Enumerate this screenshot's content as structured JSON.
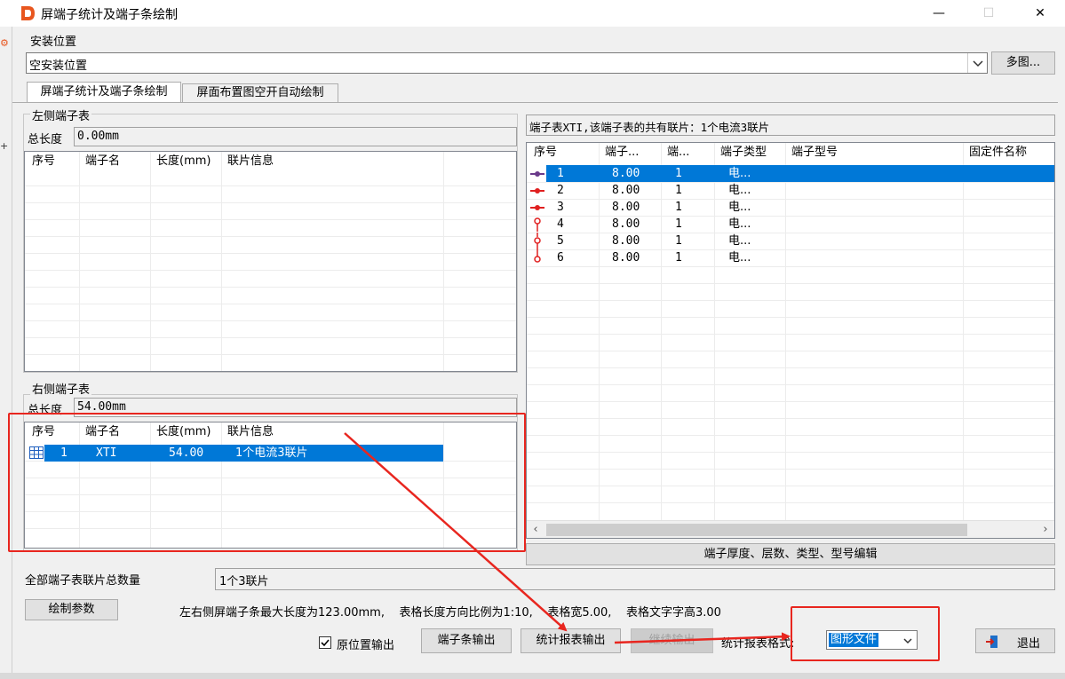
{
  "window": {
    "title": "屏端子统计及端子条绘制",
    "minimize": "—",
    "maximize": "☐",
    "close": "✕"
  },
  "install_location": {
    "group_label": "安装位置",
    "value": "空安装位置",
    "multi_button": "多图..."
  },
  "tabs": [
    {
      "label": "屏端子统计及端子条绘制"
    },
    {
      "label": "屏面布置图空开自动绘制"
    }
  ],
  "left_table": {
    "group_label": "左侧端子表",
    "total_length_label": "总长度",
    "total_length_value": "0.00mm",
    "columns": [
      "序号",
      "端子名",
      "长度(mm)",
      "联片信息"
    ],
    "rows": []
  },
  "right_table": {
    "group_label": "右侧端子表",
    "total_length_label": "总长度",
    "total_length_value": "54.00mm",
    "columns": [
      "序号",
      "端子名",
      "长度(mm)",
      "联片信息"
    ],
    "rows": [
      {
        "index": "1",
        "name": "XTI",
        "length": "54.00",
        "link": "1个电流3联片"
      }
    ]
  },
  "terminal_info": {
    "summary": "端子表XTI,该端子表的共有联片：1个电流3联片",
    "columns": [
      "序号",
      "端子...",
      "端...",
      "端子类型",
      "端子型号",
      "固定件名称"
    ],
    "rows": [
      {
        "index": "1",
        "thickness": "8.00",
        "layers": "1",
        "type": "电..."
      },
      {
        "index": "2",
        "thickness": "8.00",
        "layers": "1",
        "type": "电..."
      },
      {
        "index": "3",
        "thickness": "8.00",
        "layers": "1",
        "type": "电..."
      },
      {
        "index": "4",
        "thickness": "8.00",
        "layers": "1",
        "type": "电..."
      },
      {
        "index": "5",
        "thickness": "8.00",
        "layers": "1",
        "type": "电..."
      },
      {
        "index": "6",
        "thickness": "8.00",
        "layers": "1",
        "type": "电..."
      }
    ],
    "edit_button": "端子厚度、层数、类型、型号编辑"
  },
  "summary": {
    "total_links_label": "全部端子表联片总数量",
    "total_links_value": "1个3联片",
    "draw_params_button": "绘制参数",
    "info_line": "左右侧屏端子条最大长度为123.00mm,    表格长度方向比例为1:10,    表格宽5.00,    表格文字字高3.00"
  },
  "bottom": {
    "original_position_label": "原位置输出",
    "original_position_checked": true,
    "terminal_output_button": "端子条输出",
    "stat_report_button": "统计报表输出",
    "continue_output_button": "继续输出",
    "report_format_label": "统计报表格式:",
    "report_format_value": "图形文件",
    "exit_button": "退出"
  },
  "colors": {
    "selection": "#0078d7",
    "highlight_red": "#e8261f",
    "dialog_bg": "#f0f0f0"
  },
  "icons": {
    "app": "app-logo-icon",
    "dropdown": "chevron-down-icon",
    "exit": "exit-door-icon",
    "table_row": "table-grid-icon",
    "scroll_left": "chevron-left-icon",
    "scroll_right": "chevron-right-icon"
  }
}
